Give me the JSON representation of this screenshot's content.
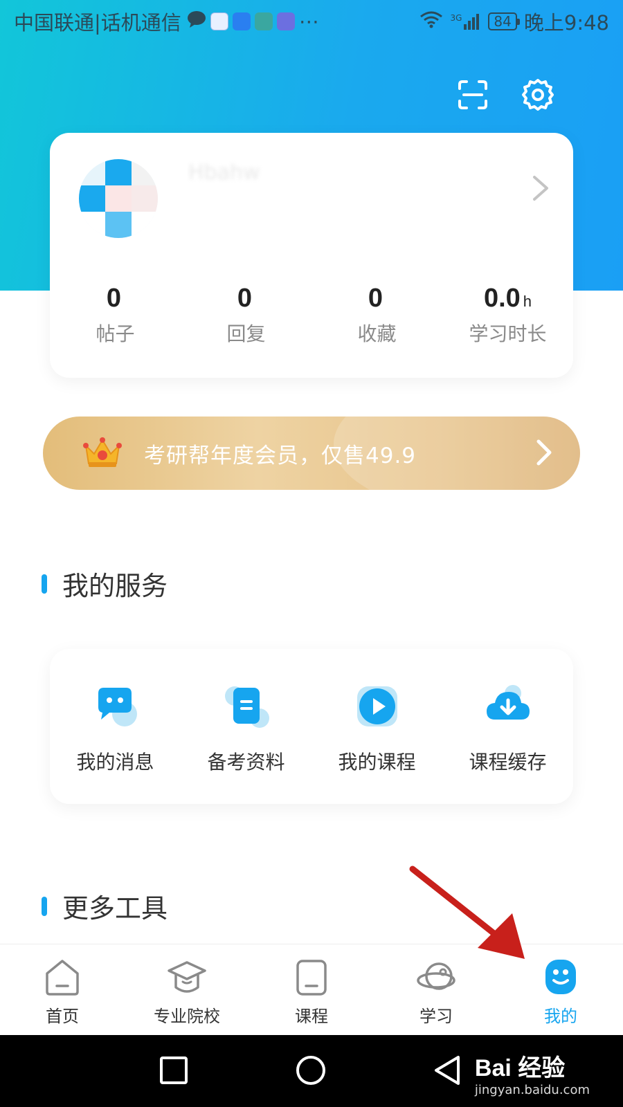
{
  "status_bar": {
    "carrier": "中国联通|话机通信",
    "network": "3G",
    "battery": "84",
    "time": "晚上9:48"
  },
  "profile": {
    "username": "Hbahw",
    "stats": [
      {
        "value": "0",
        "unit": "",
        "label": "帖子"
      },
      {
        "value": "0",
        "unit": "",
        "label": "回复"
      },
      {
        "value": "0",
        "unit": "",
        "label": "收藏"
      },
      {
        "value": "0.0",
        "unit": "h",
        "label": "学习时长"
      }
    ]
  },
  "vip_banner": {
    "text": "考研帮年度会员，仅售49.9"
  },
  "services": {
    "title": "我的服务",
    "items": [
      {
        "label": "我的消息",
        "icon": "message-icon"
      },
      {
        "label": "备考资料",
        "icon": "document-icon"
      },
      {
        "label": "我的课程",
        "icon": "play-icon"
      },
      {
        "label": "课程缓存",
        "icon": "cloud-download-icon"
      }
    ]
  },
  "more_tools": {
    "title": "更多工具"
  },
  "tabbar": {
    "items": [
      {
        "label": "首页",
        "icon": "home-icon"
      },
      {
        "label": "专业院校",
        "icon": "graduation-cap-icon"
      },
      {
        "label": "课程",
        "icon": "course-icon"
      },
      {
        "label": "学习",
        "icon": "study-icon"
      },
      {
        "label": "我的",
        "icon": "profile-face-icon",
        "active": true
      }
    ]
  },
  "watermark": {
    "brand": "Bai 经验",
    "url": "jingyan.baidu.com"
  },
  "colors": {
    "accent": "#16a5ef",
    "hero_start": "#12c6d9",
    "hero_end": "#1a9ff5",
    "gold": "#e3bd7a"
  }
}
